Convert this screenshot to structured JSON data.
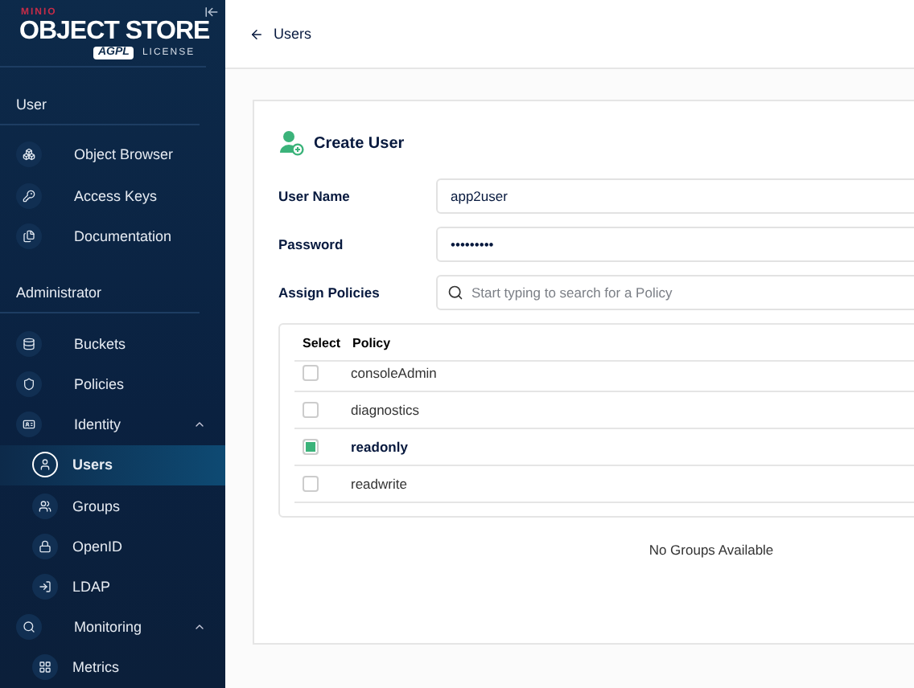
{
  "sidebar": {
    "logo": {
      "brand": "MINIO",
      "product": "OBJECT STORE",
      "license_badge": "AGPL",
      "license": "LICENSE"
    },
    "sections": [
      {
        "title": "User",
        "items": [
          {
            "label": "Object Browser",
            "selected": false
          },
          {
            "label": "Access Keys",
            "selected": false
          },
          {
            "label": "Documentation",
            "selected": false
          }
        ]
      },
      {
        "title": "Administrator",
        "items": [
          {
            "label": "Buckets",
            "selected": false
          },
          {
            "label": "Policies",
            "selected": false
          },
          {
            "label": "Identity",
            "selected": false,
            "expanded": true,
            "children": [
              {
                "label": "Users",
                "selected": true
              },
              {
                "label": "Groups",
                "selected": false
              },
              {
                "label": "OpenID",
                "selected": false
              },
              {
                "label": "LDAP",
                "selected": false
              }
            ]
          },
          {
            "label": "Monitoring",
            "selected": false,
            "expanded": true,
            "children": [
              {
                "label": "Metrics",
                "selected": false
              }
            ]
          }
        ]
      }
    ]
  },
  "breadcrumb": {
    "back_label": "Users"
  },
  "form": {
    "title": "Create User",
    "fields": [
      {
        "label": "User Name",
        "value": "app2user"
      },
      {
        "label": "Password",
        "value": "•••••••••"
      }
    ],
    "policy_search": {
      "label": "Assign Policies",
      "placeholder": "Start typing to search for a Policy"
    },
    "policy_table": {
      "columns": [
        "Select",
        "Policy"
      ],
      "rows": [
        {
          "policy": "consoleAdmin",
          "checked": false
        },
        {
          "policy": "diagnostics",
          "checked": false
        },
        {
          "policy": "readonly",
          "checked": true
        },
        {
          "policy": "readwrite",
          "checked": false
        }
      ]
    },
    "groups_message": "No Groups Available"
  }
}
